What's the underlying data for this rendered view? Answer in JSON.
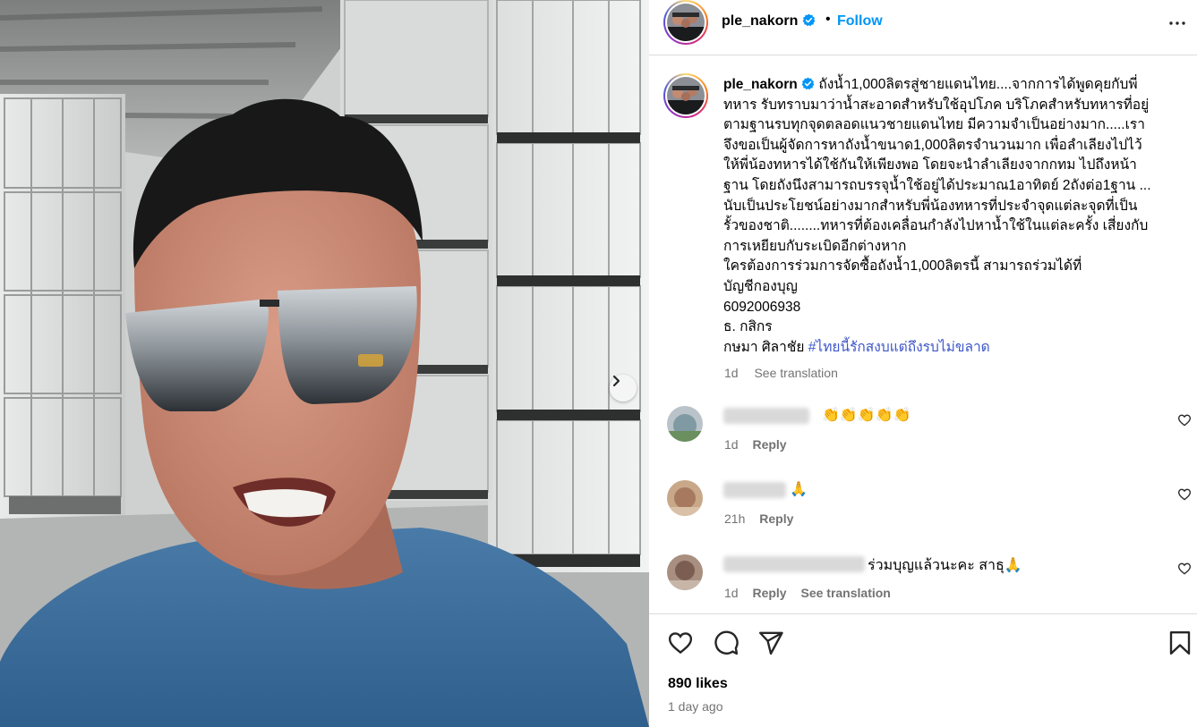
{
  "header": {
    "username": "ple_nakorn",
    "separator": "•",
    "follow_label": "Follow",
    "more_icon": "more-horizontal-icon"
  },
  "caption": {
    "username": "ple_nakorn",
    "lines": [
      "ถังน้ำ1,000ลิตรสู่ชายแดนไทย....จากการได้พูดคุยกับพี่",
      "ทหาร รับทราบมาว่าน้ำสะอาดสำหรับใช้อุปโภค บริโภคสำหรับทหารที่อยู่",
      "ตามฐานรบทุกจุดตลอดแนวชายแดนไทย มีความจำเป็นอย่างมาก.....เรา",
      "จึงขอเป็นผู้จัดการหาถังน้ำขนาด1,000ลิตรจำนวนมาก เพื่อลำเลียงไปไว้",
      "ให้พี่น้องทหารได้ใช้กันให้เพียงพอ โดยจะนำลำเลียงจากกทม ไปถึงหน้า",
      "ฐาน โดยถังนึงสามารถบรรจุน้ำใช้อยู่ได้ประมาณ1อาทิตย์ 2ถังต่อ1ฐาน ...",
      "นับเป็นประโยชน์อย่างมากสำหรับพี่น้องทหารที่ประจำจุดแต่ละจุดที่เป็น",
      "รั้วของชาติ........ทหารที่ต้องเคลื่อนกำลังไปหาน้ำใช้ในแต่ละครั้ง เสี่ยงกับ",
      "การเหยียบกับระเบิดอีกต่างหาก",
      "ใครต้องการร่วมการจัดซื้อถังน้ำ1,000ลิตรนี้ สามารถร่วมได้ที่",
      "บัญชีกองบุญ",
      "6092006938",
      "ธ. กสิกร"
    ],
    "last_line_text": "กษมา ศิลาชัย ",
    "hashtag": "#ไทยนี้รักสงบแต่ถึงรบไม่ขลาด",
    "time": "1d",
    "see_translation": "See translation"
  },
  "comments": [
    {
      "text": "👏👏👏👏👏",
      "time": "1d",
      "reply": "Reply",
      "see_translation": ""
    },
    {
      "text": "🙏",
      "time": "21h",
      "reply": "Reply",
      "see_translation": ""
    },
    {
      "text": "ร่วมบุญแล้วนะคะ สาธุ🙏",
      "time": "1d",
      "reply": "Reply",
      "see_translation": "See translation"
    }
  ],
  "actions": {
    "like_icon": "heart-icon",
    "comment_icon": "comment-icon",
    "share_icon": "share-icon",
    "save_icon": "bookmark-icon"
  },
  "likes": "890 likes",
  "posted_ago": "1 day ago",
  "colors": {
    "accent": "#0095f6",
    "hashtag": "#3e57c9",
    "muted": "#737373",
    "divider": "#dbdbdb",
    "shirt": "#3d6e9a"
  }
}
